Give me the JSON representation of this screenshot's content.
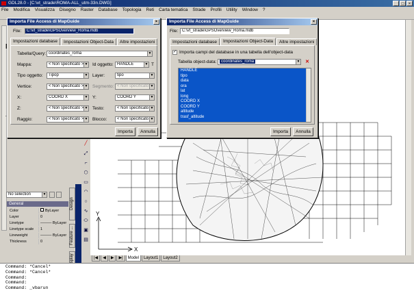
{
  "app": {
    "title": "GDL28.0 - [C:\\vt_strade\\ROMA-ALL_utm-33n.DWG]",
    "window_buttons": [
      "_",
      "□",
      "×"
    ]
  },
  "menubar": [
    "File",
    "Modifica",
    "Visualizza",
    "Disegno",
    "Raster",
    "Database",
    "Topologia",
    "Reti",
    "Carta tematica",
    "Strade",
    "Profili",
    "Utility",
    "Window",
    "?"
  ],
  "dialog1": {
    "title": "Importa File Access di MapGuide",
    "file_label": "File:",
    "file_value": "C:\\vt_strade\\GPSOverview_Roma.mdb",
    "tabs": [
      "Impostazioni database",
      "Impostazioni Object-Data",
      "Altre impostazioni"
    ],
    "table_label": "Tabella/Query:",
    "table_value": "coordinates_roma",
    "rows": [
      {
        "l1": "Mappa:",
        "v1": "< Non specificato >",
        "l2": "Id oggetto:",
        "v2": "HANDLE",
        "extra": "T"
      },
      {
        "l1": "Tipo oggetto:",
        "v1": "Tipop",
        "l2": "Layer:",
        "v2": "tipo"
      },
      {
        "l1": "Vertice:",
        "v1": "< Non specificato >",
        "l2": "Segmento:",
        "v2": "< Non specificato >"
      },
      {
        "l1": "X:",
        "v1": "COORD X",
        "l2": "Y:",
        "v2": "COORD Y"
      },
      {
        "l1": "Z:",
        "v1": "< Non specificato >",
        "l2": "Testo:",
        "v2": "< Non specificato >"
      },
      {
        "l1": "Raggio:",
        "v1": "< Non specificato >",
        "l2": "Blocco:",
        "v2": "< Non specificato >"
      }
    ],
    "import_button": "Importa",
    "cancel_button": "Annulla"
  },
  "dialog2": {
    "title": "Importa File Access di MapGuide",
    "file_label": "File:",
    "file_value": "C:\\vt_strade\\GPSOverview_Roma.mdb",
    "tabs": [
      "Impostazioni database",
      "Impostazioni Object-Data",
      "Altre impostazioni"
    ],
    "checkbox_label": "Importa campi del database in una tabella dell'object-data",
    "checkbox_checked": true,
    "od_table_label": "Tabella object-data:",
    "od_table_value": "coordinates_roma",
    "fields": [
      "HANDLE",
      "tipo",
      "data",
      "ora",
      "lat",
      "long",
      "COORD X",
      "COORD Y",
      "altitude",
      "trasf_altitude"
    ],
    "import_button": "Importa",
    "cancel_button": "Annulla"
  },
  "left_panel": {
    "selection_label": "No selection",
    "section_title": "General",
    "properties": [
      {
        "k": "Color",
        "v": "ByLayer"
      },
      {
        "k": "Layer",
        "v": "0"
      },
      {
        "k": "Linetype",
        "v": "——— ByLayer"
      },
      {
        "k": "Linetype scale",
        "v": "1"
      },
      {
        "k": "Lineweight",
        "v": "——— ByLayer"
      },
      {
        "k": "Thickness",
        "v": "0"
      }
    ],
    "side_tabs": [
      "Design",
      "Feature ...",
      "Display"
    ],
    "map_label_fragment": "M"
  },
  "layout_tabs": [
    "Model",
    "Layout1",
    "Layout2"
  ],
  "command_lines": [
    "Command: *Cancel*",
    "Command: *Cancel*",
    "Command:",
    "Command:",
    "Command: _vbarun"
  ],
  "axis": {
    "y": "Y",
    "x": "X"
  }
}
